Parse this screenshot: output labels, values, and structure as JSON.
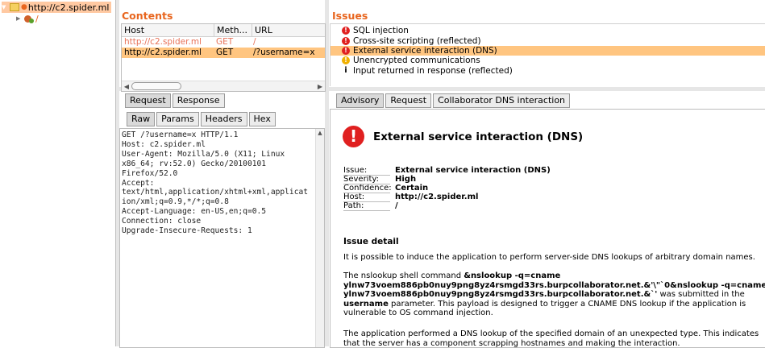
{
  "tree": {
    "root_label": "http://c2.spider.ml",
    "child_label": "/"
  },
  "contents": {
    "title": "Contents",
    "columns": [
      "Host",
      "Meth...",
      "URL"
    ],
    "rows": [
      {
        "host": "http://c2.spider.ml",
        "method": "GET",
        "url": "/"
      },
      {
        "host": "http://c2.spider.ml",
        "method": "GET",
        "url": "/?username=x"
      }
    ]
  },
  "issues": {
    "title": "Issues",
    "items": [
      {
        "label": "SQL injection",
        "severity": "high"
      },
      {
        "label": "Cross-site scripting (reflected)",
        "severity": "high"
      },
      {
        "label": "External service interaction (DNS)",
        "severity": "high"
      },
      {
        "label": "Unencrypted communications",
        "severity": "low"
      },
      {
        "label": "Input returned in response (reflected)",
        "severity": "info"
      }
    ]
  },
  "request_tabs": [
    "Request",
    "Response"
  ],
  "raw_tabs": [
    "Raw",
    "Params",
    "Headers",
    "Hex"
  ],
  "request_lines": [
    "GET /?username=x HTTP/1.1",
    "Host: c2.spider.ml",
    "User-Agent: Mozilla/5.0 (X11; Linux",
    "x86_64; rv:52.0) Gecko/20100101",
    "Firefox/52.0",
    "Accept:",
    "text/html,application/xhtml+xml,applicat",
    "ion/xml;q=0.9,*/*;q=0.8",
    "Accept-Language: en-US,en;q=0.5",
    "Connection: close",
    "Upgrade-Insecure-Requests: 1"
  ],
  "advisory_tabs": [
    "Advisory",
    "Request",
    "Collaborator DNS interaction"
  ],
  "advisory": {
    "title": "External service interaction (DNS)",
    "fields": [
      {
        "key": "Issue:",
        "value": "External service interaction (DNS)"
      },
      {
        "key": "Severity:",
        "value": "High"
      },
      {
        "key": "Confidence:",
        "value": "Certain"
      },
      {
        "key": "Host:",
        "value": "http://c2.spider.ml"
      },
      {
        "key": "Path:",
        "value": "/"
      }
    ],
    "detail_heading": "Issue detail",
    "para1": "It is possible to induce the application to perform server-side DNS lookups of arbitrary domain names.",
    "para2_a": "The nslookup shell command ",
    "para2_cmd": "&nslookup -q=cname ylnw73voem886pb0nuy9png8yz4rsmgd33rs.burpcollaborator.net.&'\\\"`0&nslookup -q=cname ylnw73voem886pb0nuy9png8yz4rsmgd33rs.burpcollaborator.net.&`'",
    "para2_b": " was submitted in the ",
    "para2_param": "username",
    "para2_c": " parameter. This payload is designed to trigger a CNAME DNS lookup if the application is vulnerable to OS command injection.",
    "para3": "The application performed a DNS lookup of the specified domain of an unexpected type. This indicates that the server has a component scrapping hostnames and making the interaction."
  },
  "colors": {
    "accent": "#e8661f",
    "selection": "#ffc580",
    "high": "#e02020",
    "low": "#f0b000"
  }
}
